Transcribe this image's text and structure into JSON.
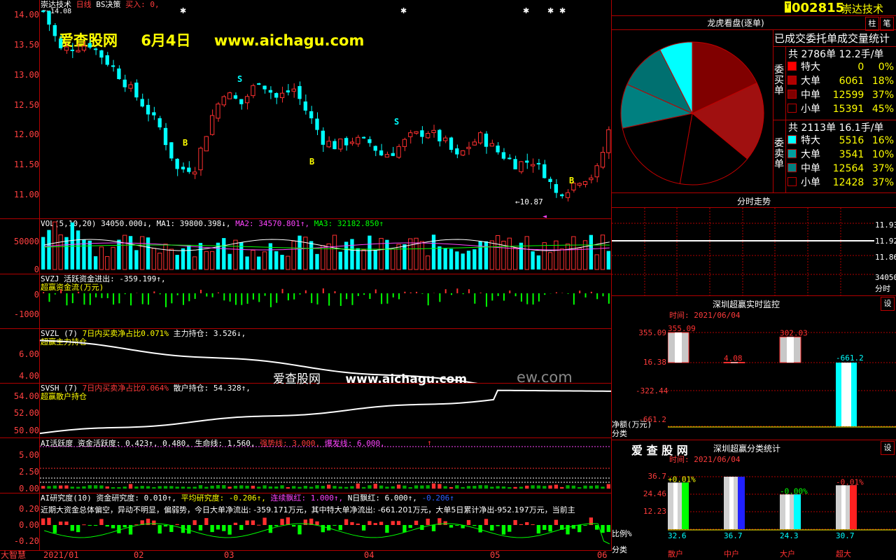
{
  "header": {
    "title": "崇达技术",
    "period": "日线",
    "indicator": "BS决策",
    "buy_label": "买入: 0,",
    "price_hint": "14.08",
    "stock_code": "002815",
    "stock_name": "崇达技术",
    "tab1": "柱",
    "tab2": "笔"
  },
  "watermark": {
    "site": "爱查股网",
    "date": "6月4日",
    "url": "www.aichagu.com",
    "mid_site": "爱查股网",
    "mid_url": "www.aichagu.com",
    "mid_tail": "ew.com"
  },
  "main_axis": [
    "14.00",
    "13.50",
    "13.00",
    "12.50",
    "12.00",
    "11.50",
    "11.00"
  ],
  "main_low": "10.87",
  "bs_markers": [
    "B",
    "S",
    "B",
    "S",
    "B"
  ],
  "vol": {
    "title": "VOL(5,10,20)",
    "value": "34050.000↓,",
    "ma1": "MA1: 39800.398↓,",
    "ma2": "MA2: 34570.801↑,",
    "ma3": "MA3: 32182.850↑",
    "axis": [
      "50000",
      "0"
    ]
  },
  "svzj": {
    "title": "SVZJ",
    "line": "活跃资金进出: -359.199↑,",
    "sub": "超赢资金流(万元)",
    "axis": [
      "0",
      "-1000"
    ]
  },
  "svzl": {
    "title": "SVZL (7)",
    "line": "7日内买卖净占比0.071%",
    "hold": "主力持仓: 3.526↓,",
    "sub": "超赢主力持仓",
    "axis": [
      "6.00",
      "5.00",
      "4.00"
    ]
  },
  "svsh": {
    "title": "SVSH (7)",
    "line": "7日内买卖净占比0.064%",
    "hold": "散户持仓: 54.328↑,",
    "sub": "超赢散户持仓",
    "axis": [
      "54.00",
      "52.00",
      "50.00"
    ]
  },
  "ai1": {
    "title": "AI活跃度",
    "a": "资金活跃度: 0.423↑,",
    "b": "0.480,",
    "c": "生命线: 1.560,",
    "d": "强势线: 3.000,",
    "e": "爆发线: 6.000,",
    "axis": [
      "5.00",
      "2.50",
      "0.00"
    ]
  },
  "ai2": {
    "title": "AI研究度(10)",
    "a": "资金研究度: 0.010↑,",
    "b": "平均研究度: -0.206↑,",
    "c": "连续飘红: 1.000↑,",
    "d": "N日飘红: 6.000↑,",
    "e": "-0.206↑",
    "comment": "近期大资金总体偏空，异动不明显，偏弱势，今日大单净流出: -359.171万元，其中特大单净流出: -661.201万元，大单5日累计净出-952.197万元，当前主",
    "axis": [
      "0.20",
      "0.00",
      "-0.20"
    ]
  },
  "bottom_axis": {
    "logo": "大智慧",
    "months": [
      "2021/01",
      "02",
      "03",
      "04",
      "05",
      "06"
    ]
  },
  "right": {
    "panel1_title": "龙虎看盘(逐单)",
    "panel1_sub": "已成交委托单成交量统计",
    "buy_side_label": "委买单",
    "sell_side_label": "委卖单",
    "buy_total": "共 2786单 12.2手/单",
    "sell_total": "共 2113单 16.1手/单",
    "buy_rows": [
      {
        "name": "特大",
        "vol": "0",
        "pct": "0%",
        "color": "#ff0000"
      },
      {
        "name": "大单",
        "vol": "6061",
        "pct": "18%",
        "color": "#b00000"
      },
      {
        "name": "中单",
        "vol": "12599",
        "pct": "37%",
        "color": "#800000"
      },
      {
        "name": "小单",
        "vol": "15391",
        "pct": "45%",
        "color": "#000000"
      }
    ],
    "sell_rows": [
      {
        "name": "特大",
        "vol": "5516",
        "pct": "16%",
        "color": "#00ffff"
      },
      {
        "name": "大单",
        "vol": "3541",
        "pct": "10%",
        "color": "#00a0a0"
      },
      {
        "name": "中单",
        "vol": "12564",
        "pct": "37%",
        "color": "#008080"
      },
      {
        "name": "小单",
        "vol": "12428",
        "pct": "37%",
        "color": "#000000"
      }
    ],
    "panel2_title": "分时走势",
    "p2_axis": [
      "11.93",
      "11.92",
      "11.86",
      "34050",
      "分时"
    ],
    "panel3_title": "深圳超赢实时监控",
    "panel3_btn": "设",
    "panel3_time": "时间: 2021/06/04",
    "p3_axis": [
      "355.09",
      "16.38",
      "-322.44",
      "-661.2"
    ],
    "p3_unit": "净额(万元)",
    "p3_cat": "分类",
    "p3_bars": [
      {
        "label": "散户",
        "value": 355.09,
        "text": "355.09"
      },
      {
        "label": "中户",
        "value": 4.08,
        "text": "4.08"
      },
      {
        "label": "大户",
        "value": 302.03,
        "text": "302.03"
      },
      {
        "label": "超大",
        "value": -661.2,
        "text": "-661.2"
      }
    ],
    "panel4_logo": "爱 查 股 网",
    "panel4_title": "深圳超赢分类统计",
    "panel4_btn": "设",
    "panel4_time": "时间: 2021/06/04",
    "p4_axis": [
      "36.7",
      "24.46",
      "12.23",
      "0"
    ],
    "p4_unit": "比例%",
    "p4_cat": "分类",
    "p4_bars": [
      {
        "label": "散户",
        "value": 32.6,
        "text": "32.6",
        "change": "+0.01%",
        "color": "#00ff00"
      },
      {
        "label": "中户",
        "value": 36.7,
        "text": "36.7",
        "change": "",
        "color": "#2020ff"
      },
      {
        "label": "大户",
        "value": 24.3,
        "text": "24.3",
        "change": "-0.00%",
        "color": "#00ffff"
      },
      {
        "label": "超大",
        "value": 30.7,
        "text": "30.7",
        "change": "-0.01%",
        "color": "#ff2020"
      }
    ]
  },
  "colors": {
    "up": "#ff3030",
    "down": "#00ffff",
    "frame": "#b00000"
  }
}
